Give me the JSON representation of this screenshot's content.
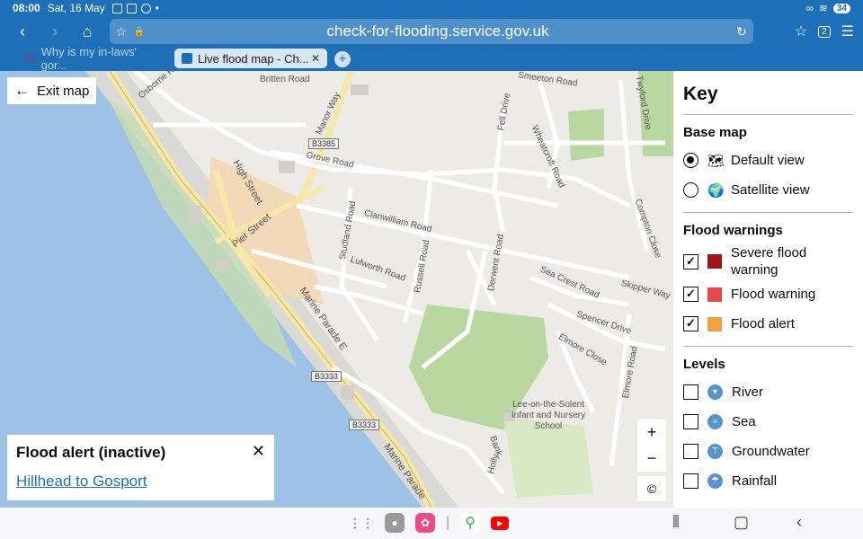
{
  "status": {
    "time": "08:00",
    "date": "Sat, 16 May",
    "battery": "34"
  },
  "browser": {
    "url": "check-for-flooding.service.gov.uk",
    "tabs": [
      {
        "label": "Why is my in-laws' gor..."
      },
      {
        "label": "Live flood map - Ch..."
      }
    ],
    "tab_count": "2"
  },
  "map": {
    "exit_label": "Exit map",
    "labels": {
      "britten": "Britten Road",
      "osborne": "Osborne R",
      "manor": "Manor Way",
      "shireton": "Smeeton Road",
      "fell": "Fell Drive",
      "twyford": "Twyford Drive",
      "wheatcroft": "Wheatcroft Road",
      "grove": "Grove Road",
      "high": "High Street",
      "pier": "Pier Street",
      "clanwilliam": "Clanwilliam Road",
      "studland": "Studland Road",
      "lulworth": "Lulworth Road",
      "russell": "Russell Road",
      "derwent": "Derwent Road",
      "compton": "Compton Close",
      "seacrest": "Sea Crest Road",
      "skipper": "Skipper Way",
      "spencer": "Spencer Drive",
      "elmore_close": "Elmore Close",
      "elmore_road": "Elmore Road",
      "marine_e": "Marine Parade E",
      "marine": "Marine Parade",
      "holly": "Holly",
      "bank": "Bank",
      "school": "Lee-on-the-Solent Infant and Nursery School"
    },
    "badges": [
      "B3385",
      "B3333",
      "B3333"
    ],
    "zoom_in": "+",
    "zoom_out": "−",
    "attribution": "©"
  },
  "info_panel": {
    "title": "Flood alert (inactive)",
    "link": "Hillhead to Gosport"
  },
  "key": {
    "title": "Key",
    "base_map": {
      "heading": "Base map",
      "options": [
        {
          "label": "Default view",
          "selected": true
        },
        {
          "label": "Satellite view",
          "selected": false
        }
      ]
    },
    "flood_warnings": {
      "heading": "Flood warnings",
      "items": [
        {
          "label": "Severe flood warning",
          "color": "#a0141b",
          "checked": true
        },
        {
          "label": "Flood warning",
          "color": "#e5484d",
          "checked": true
        },
        {
          "label": "Flood alert",
          "color": "#f0a13a",
          "checked": true
        }
      ]
    },
    "levels": {
      "heading": "Levels",
      "items": [
        {
          "label": "River",
          "checked": false
        },
        {
          "label": "Sea",
          "checked": false
        },
        {
          "label": "Groundwater",
          "checked": false
        },
        {
          "label": "Rainfall",
          "checked": false
        }
      ]
    }
  },
  "colors": {
    "chrome": "#1d6fb8",
    "sea": "#9ec1e6",
    "park": "#b9d8a1",
    "town": "#f2d9b8"
  }
}
